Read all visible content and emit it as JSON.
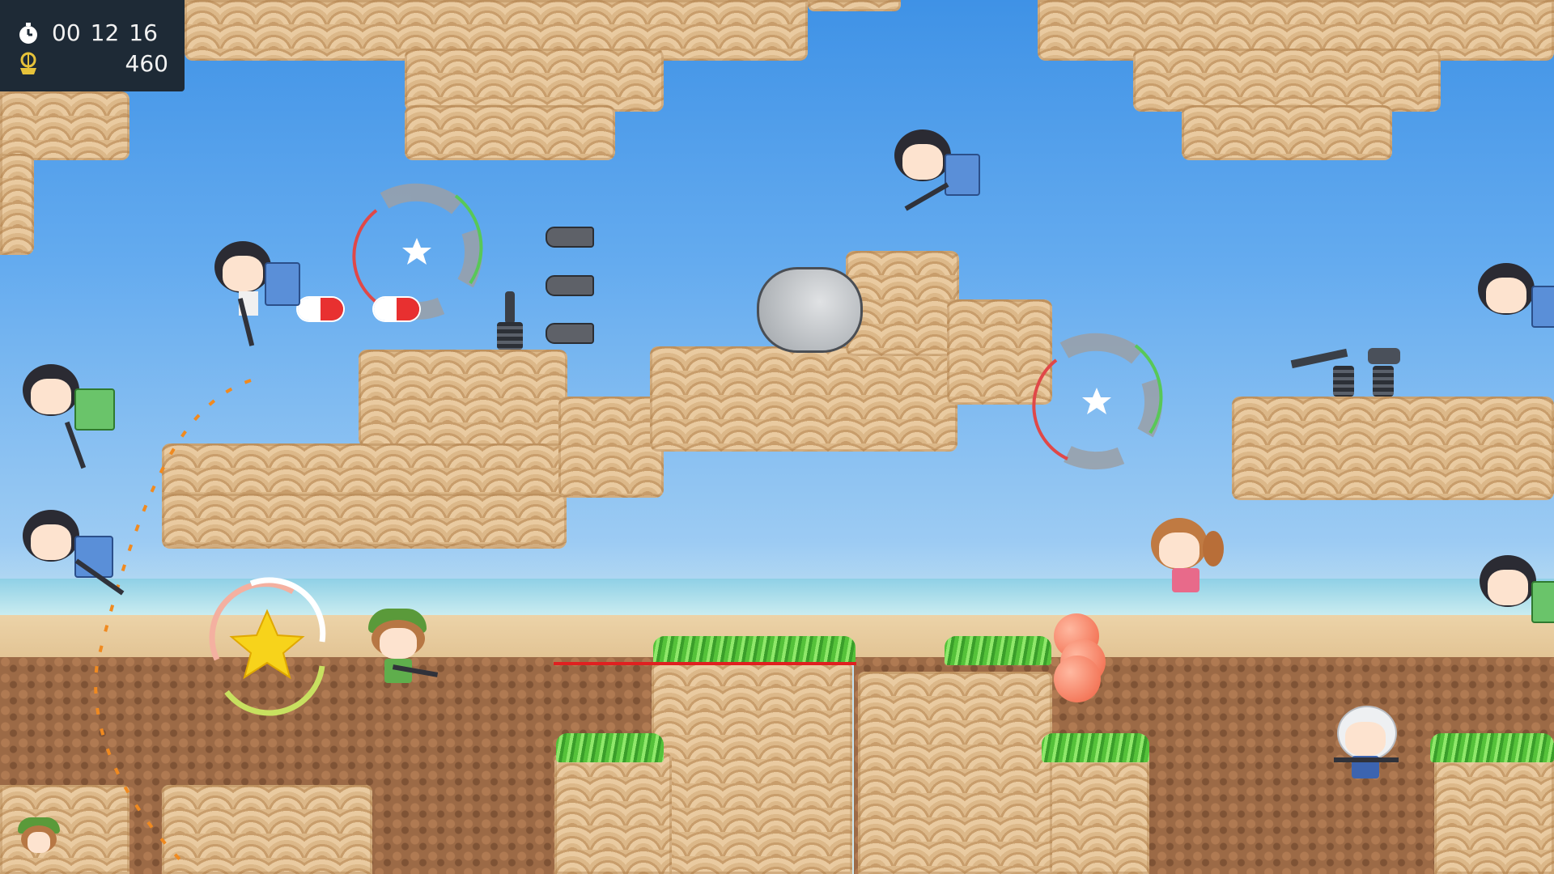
{
  "hud": {
    "timer": {
      "icon": "stopwatch-icon",
      "hours": "00",
      "minutes": "12",
      "seconds": "16"
    },
    "score": {
      "icon": "gold-emblem-icon",
      "value": "460"
    }
  },
  "colors": {
    "sky_top": "#3f92e6",
    "sky_bottom": "#cfe8f0",
    "sand": "#d8b484",
    "dirt": "#9c6a46",
    "grass": "#55c23a",
    "hud_bg": "#1e2a36",
    "laser": "#e02020",
    "star_gold": "#f7d31b"
  }
}
